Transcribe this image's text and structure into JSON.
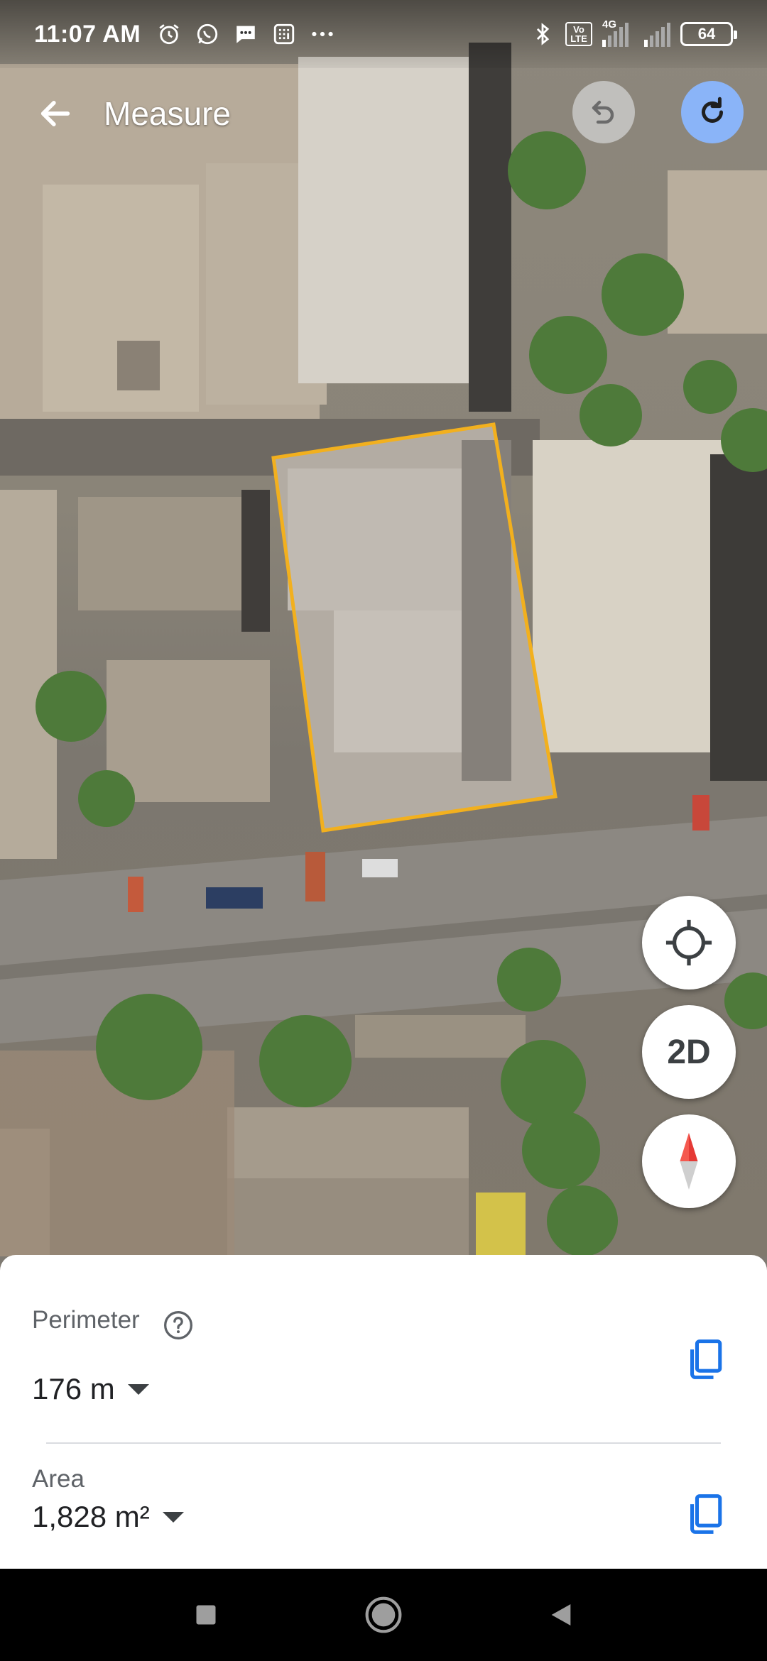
{
  "status_bar": {
    "time": "11:07 AM",
    "network_label": "4G",
    "volte_label": "Vo LTE",
    "battery_level": "64",
    "left_icons": [
      "alarm-icon",
      "whatsapp-icon",
      "message-icon",
      "calculator-icon",
      "more-dots-icon"
    ],
    "right_icons": [
      "bluetooth-icon",
      "volte-icon",
      "signal-icon",
      "signal-icon",
      "battery-icon"
    ]
  },
  "app_bar": {
    "title": "Measure",
    "back_icon": "arrow-back-icon",
    "undo_icon": "undo-icon",
    "redo_icon": "redo-icon"
  },
  "map_controls": {
    "locate_icon": "my-location-icon",
    "view_mode_label": "2D",
    "compass_icon": "compass-icon"
  },
  "measurement": {
    "perimeter_label": "Perimeter",
    "perimeter_value": "176 m",
    "area_label": "Area",
    "area_value": "1,828 m²",
    "polygon_color": "#f2b01e"
  },
  "nav_bar": {
    "icons": [
      "recents-square-icon",
      "home-circle-icon",
      "back-triangle-icon"
    ]
  },
  "colors": {
    "accent": "#1a73e8",
    "redo_bg": "#8ab4f8",
    "text_primary": "#202124",
    "text_secondary": "#5f6368"
  }
}
